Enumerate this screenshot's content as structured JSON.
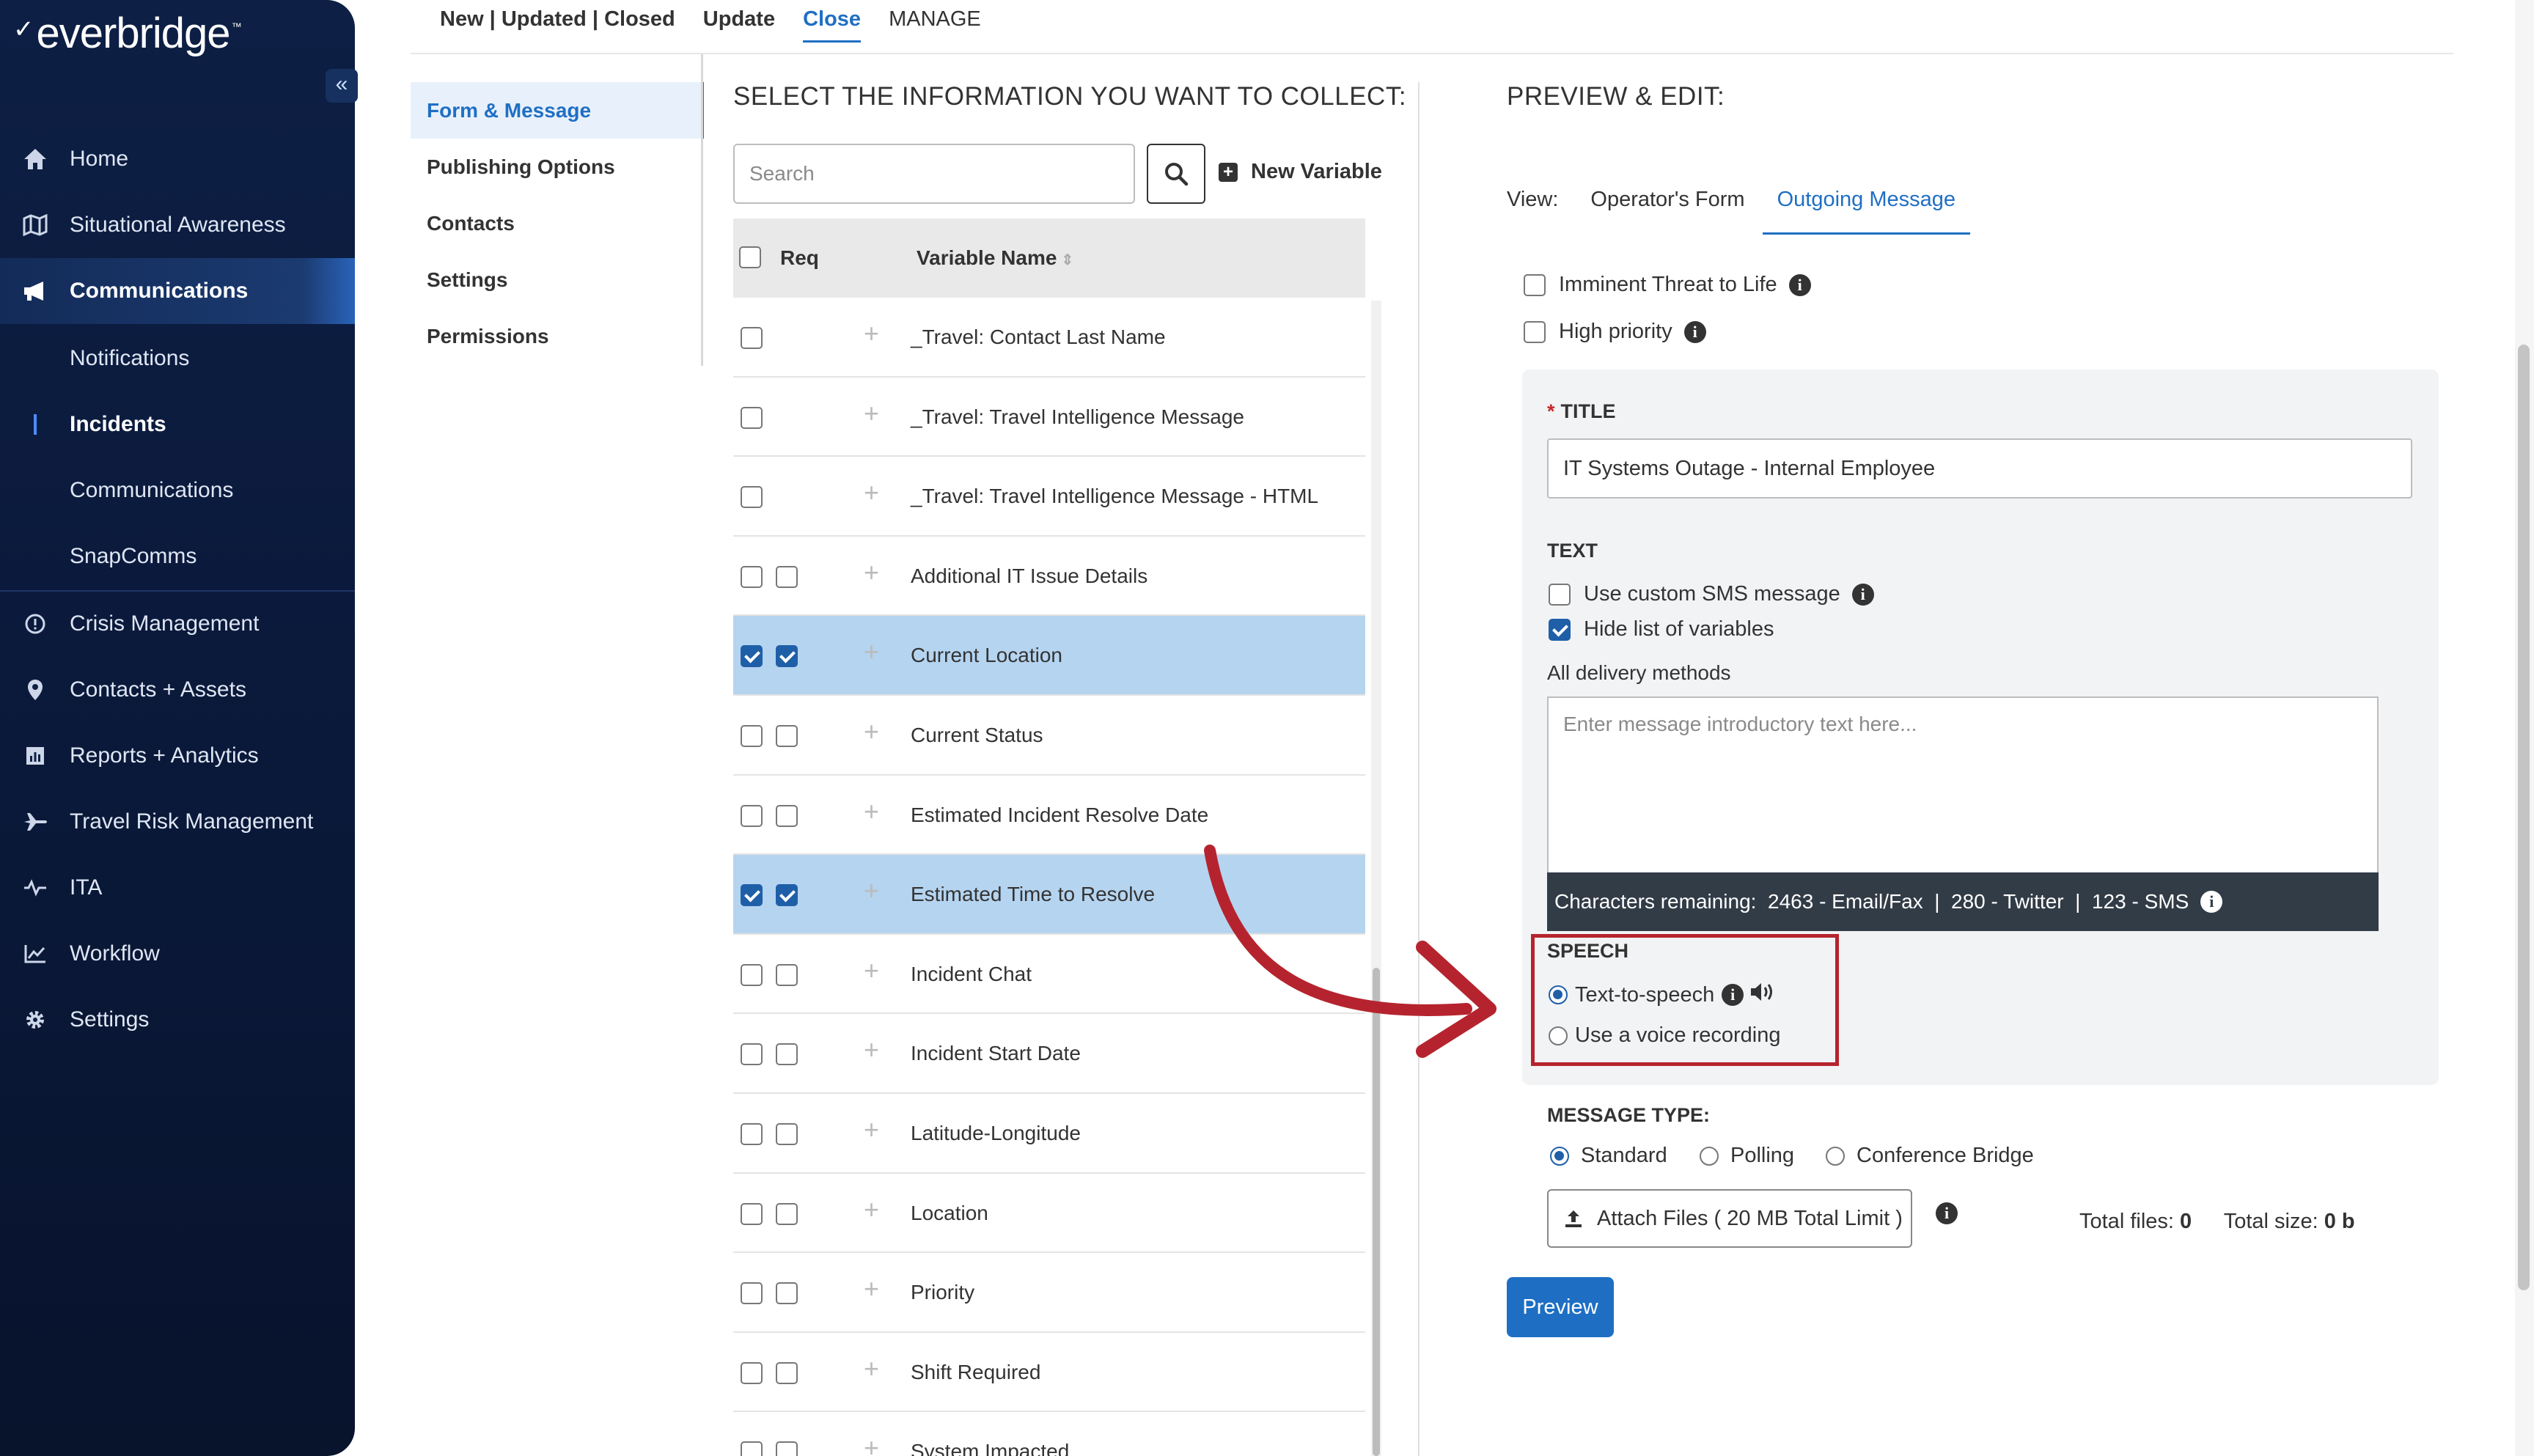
{
  "brand": {
    "logo_text": "everbridge",
    "tm": "™"
  },
  "sidebar": {
    "collapse_icon": "double-chevron-left-icon",
    "items": [
      {
        "label": "Home",
        "icon": "home-icon"
      },
      {
        "label": "Situational Awareness",
        "icon": "map-icon"
      },
      {
        "label": "Communications",
        "icon": "megaphone-icon"
      },
      {
        "label": "Notifications"
      },
      {
        "label": "Incidents"
      },
      {
        "label": "Communications"
      },
      {
        "label": "SnapComms"
      },
      {
        "label": "Crisis Management",
        "icon": "circle-info-icon"
      },
      {
        "label": "Contacts + Assets",
        "icon": "map-pin-icon"
      },
      {
        "label": "Reports + Analytics",
        "icon": "bar-chart-icon"
      },
      {
        "label": "Travel Risk Management",
        "icon": "plane-icon"
      },
      {
        "label": "ITA",
        "icon": "signal-icon"
      },
      {
        "label": "Workflow",
        "icon": "line-chart-icon"
      },
      {
        "label": "Settings",
        "icon": "gear-icon"
      }
    ]
  },
  "top_tabs": {
    "tab1": "New | Updated | Closed",
    "tab2": "Update",
    "tab3": "Close",
    "tab4": "MANAGE"
  },
  "submenu": [
    "Form & Message",
    "Publishing Options",
    "Contacts",
    "Settings",
    "Permissions"
  ],
  "collect": {
    "title": "SELECT THE INFORMATION YOU WANT TO COLLECT:",
    "search_placeholder": "Search",
    "new_variable": "New Variable",
    "header_req": "Req",
    "header_name": "Variable Name",
    "rows": [
      {
        "name": "_Travel: Contact Last Name",
        "req_box": false,
        "selected": false
      },
      {
        "name": "_Travel: Travel Intelligence Message",
        "req_box": false,
        "selected": false
      },
      {
        "name": "_Travel: Travel Intelligence Message - HTML",
        "req_box": false,
        "selected": false
      },
      {
        "name": "Additional IT Issue Details",
        "req_box": true,
        "selected": false
      },
      {
        "name": "Current Location",
        "req_box": true,
        "selected": true
      },
      {
        "name": "Current Status",
        "req_box": true,
        "selected": false
      },
      {
        "name": "Estimated Incident Resolve Date",
        "req_box": true,
        "selected": false
      },
      {
        "name": "Estimated Time to Resolve",
        "req_box": true,
        "selected": true
      },
      {
        "name": "Incident Chat",
        "req_box": true,
        "selected": false
      },
      {
        "name": "Incident Start Date",
        "req_box": true,
        "selected": false
      },
      {
        "name": "Latitude-Longitude",
        "req_box": true,
        "selected": false
      },
      {
        "name": "Location",
        "req_box": true,
        "selected": false
      },
      {
        "name": "Priority",
        "req_box": true,
        "selected": false
      },
      {
        "name": "Shift Required",
        "req_box": true,
        "selected": false
      },
      {
        "name": "System Impacted",
        "req_box": true,
        "selected": false
      }
    ]
  },
  "preview": {
    "title": "PREVIEW & EDIT:",
    "view_label": "View:",
    "view_tab1": "Operator's Form",
    "view_tab2": "Outgoing Message",
    "imminent": "Imminent Threat to Life",
    "high_priority": "High priority",
    "title_label": "TITLE",
    "title_star": "*",
    "title_value": "IT Systems Outage - Internal Employee",
    "text_label": "TEXT",
    "custom_sms": "Use custom SMS message",
    "hide_vars": "Hide list of variables",
    "all_delivery": "All delivery methods",
    "msg_placeholder": "Enter message introductory text here...",
    "chars_remaining": "Characters remaining:  2463 - Email/Fax  |  280 - Twitter  |  123 - SMS",
    "speech_label": "SPEECH",
    "tts": "Text-to-speech",
    "voice_rec": "Use a voice recording",
    "message_type_label": "MESSAGE TYPE:",
    "mt_standard": "Standard",
    "mt_polling": "Polling",
    "mt_conference": "Conference Bridge",
    "attach": "Attach Files ( 20 MB Total Limit )",
    "total_files_label": "Total files:",
    "total_files_value": "0",
    "total_size_label": "Total size:",
    "total_size_value": "0 b",
    "preview_button": "Preview"
  },
  "colors": {
    "accent": "#1f6fc4",
    "selected_row": "#b5d4f0",
    "highlight_red": "#b5242e",
    "sidebar_bg": "#0d1f44"
  }
}
